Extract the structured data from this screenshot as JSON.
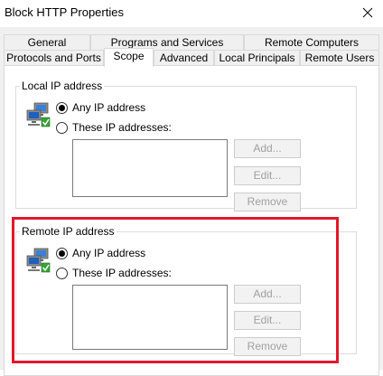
{
  "window": {
    "title": "Block HTTP Properties"
  },
  "tabs": {
    "row1": [
      "General",
      "Programs and Services",
      "Remote Computers"
    ],
    "row2": [
      "Protocols and Ports",
      "Scope",
      "Advanced",
      "Local Principals",
      "Remote Users"
    ],
    "selected": "Scope"
  },
  "local": {
    "label": "Local IP address",
    "any_label": "Any IP address",
    "these_label": "These IP addresses:",
    "selected": "any",
    "buttons": {
      "add": "Add...",
      "edit": "Edit...",
      "remove": "Remove"
    }
  },
  "remote": {
    "label": "Remote IP address",
    "any_label": "Any IP address",
    "these_label": "These IP addresses:",
    "selected": "any",
    "buttons": {
      "add": "Add...",
      "edit": "Edit...",
      "remove": "Remove"
    }
  },
  "icons": {
    "close": "close-icon",
    "network": "network-computers-icon"
  },
  "colors": {
    "highlight": "#e2172a",
    "panel": "#ffffff",
    "dialog": "#f0f0f0",
    "disabled_text": "#a0a0a0"
  }
}
